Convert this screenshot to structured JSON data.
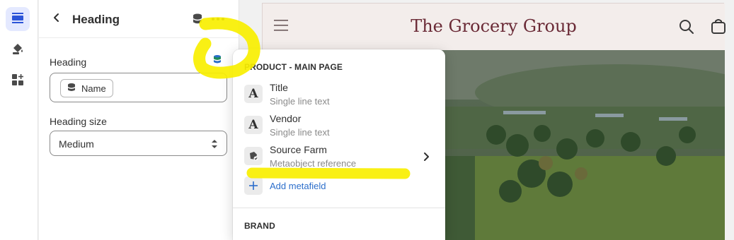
{
  "colors": {
    "accent": "#2c6ecb",
    "brand": "#6a2a36",
    "highlight": "#f9ef00",
    "rail_active": "#e4e9ff"
  },
  "sidebar": {
    "items": [
      {
        "icon": "sections-icon",
        "active": true
      },
      {
        "icon": "paint-bucket-icon",
        "active": false
      },
      {
        "icon": "apps-add-icon",
        "active": false
      }
    ]
  },
  "panel": {
    "title": "Heading",
    "fields": {
      "heading_label": "Heading",
      "heading_value": "Name",
      "size_label": "Heading size",
      "size_value": "Medium"
    }
  },
  "preview": {
    "store_title": "The Grocery Group"
  },
  "menu": {
    "section1": "PRODUCT - MAIN PAGE",
    "items": [
      {
        "icon": "A",
        "title": "Title",
        "subtitle": "Single line text"
      },
      {
        "icon": "A",
        "title": "Vendor",
        "subtitle": "Single line text"
      },
      {
        "icon": "metaobject-icon",
        "title": "Source Farm",
        "subtitle": "Metaobject reference"
      }
    ],
    "add_label": "Add metafield",
    "section2": "BRAND"
  }
}
